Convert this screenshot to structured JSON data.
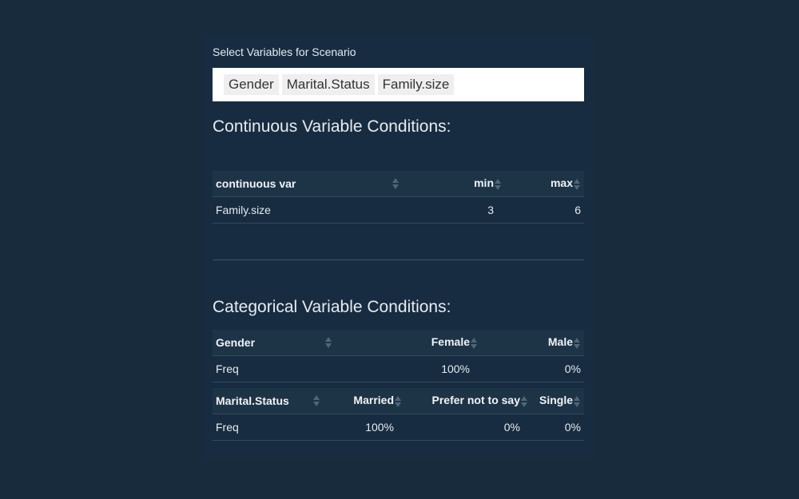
{
  "selector": {
    "label": "Select Variables for Scenario",
    "chips": [
      "Gender",
      "Marital.Status",
      "Family.size"
    ]
  },
  "continuous": {
    "heading": "Continuous Variable Conditions:",
    "columns": [
      "continuous var",
      "min",
      "max"
    ],
    "rows": [
      [
        "Family.size",
        "3",
        "6"
      ]
    ]
  },
  "categorical": {
    "heading": "Categorical Variable Conditions:",
    "tables": [
      {
        "columns": [
          "Gender",
          "Female",
          "Male"
        ],
        "rows": [
          [
            "Freq",
            "100%",
            "0%"
          ]
        ]
      },
      {
        "columns": [
          "Marital.Status",
          "Married",
          "Prefer not to say",
          "Single"
        ],
        "rows": [
          [
            "Freq",
            "100%",
            "0%",
            "0%"
          ]
        ]
      }
    ]
  },
  "colors": {
    "background": "#172b3c",
    "panel": "#182c41",
    "header_row": "#1d3447",
    "text": "#e6ebef"
  }
}
